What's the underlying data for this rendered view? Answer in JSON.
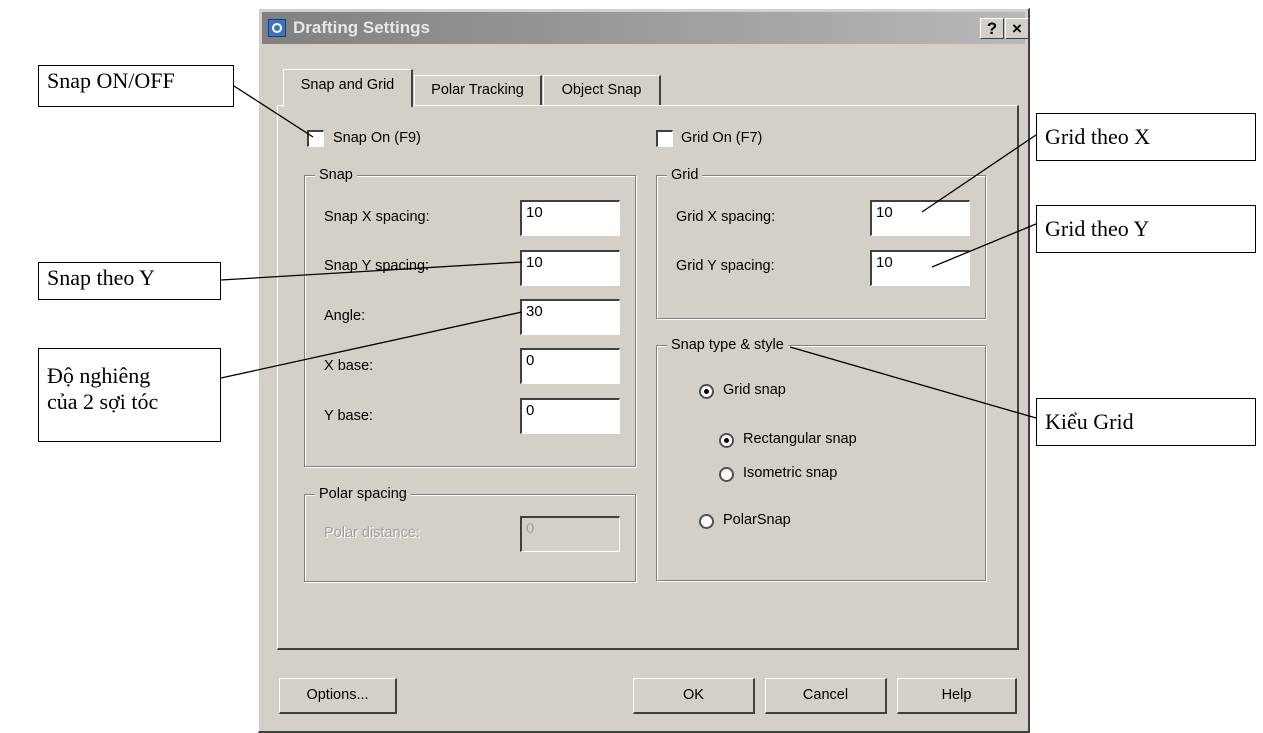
{
  "window": {
    "title": "Drafting Settings",
    "help_glyph": "?",
    "close_glyph": "×"
  },
  "tabs": [
    {
      "label": "Snap and Grid",
      "selected": true
    },
    {
      "label": "Polar Tracking",
      "selected": false
    },
    {
      "label": "Object Snap",
      "selected": false
    }
  ],
  "snap_on": {
    "label": "Snap On (F9)",
    "checked": false
  },
  "grid_on": {
    "label": "Grid On (F7)",
    "checked": false
  },
  "snap_group": {
    "title": "Snap",
    "x_spacing": {
      "label": "Snap X spacing:",
      "value": "10"
    },
    "y_spacing": {
      "label": "Snap Y spacing:",
      "value": "10"
    },
    "angle": {
      "label": "Angle:",
      "value": "30"
    },
    "x_base": {
      "label": "X base:",
      "value": "0"
    },
    "y_base": {
      "label": "Y base:",
      "value": "0"
    }
  },
  "grid_group": {
    "title": "Grid",
    "x_spacing": {
      "label": "Grid X spacing:",
      "value": "10"
    },
    "y_spacing": {
      "label": "Grid Y spacing:",
      "value": "10"
    }
  },
  "polar_group": {
    "title": "Polar spacing",
    "distance": {
      "label": "Polar distance:",
      "value": "0"
    }
  },
  "snap_type_group": {
    "title": "Snap type & style",
    "grid_snap": {
      "label": "Grid snap",
      "selected": true
    },
    "rectangular": {
      "label": "Rectangular snap",
      "selected": true
    },
    "isometric": {
      "label": "Isometric snap",
      "selected": false
    },
    "polar_snap": {
      "label": "PolarSnap",
      "selected": false
    }
  },
  "buttons": {
    "options": "Options...",
    "ok": "OK",
    "cancel": "Cancel",
    "help": "Help"
  },
  "annotations": {
    "snap_onoff": "Snap ON/OFF",
    "snap_y": "Snap theo Y",
    "angle_line1": "Độ nghiêng",
    "angle_line2": "của 2 sợi tóc",
    "grid_x": "Grid theo X",
    "grid_y": "Grid theo Y",
    "grid_style": "Kiểu Grid"
  }
}
